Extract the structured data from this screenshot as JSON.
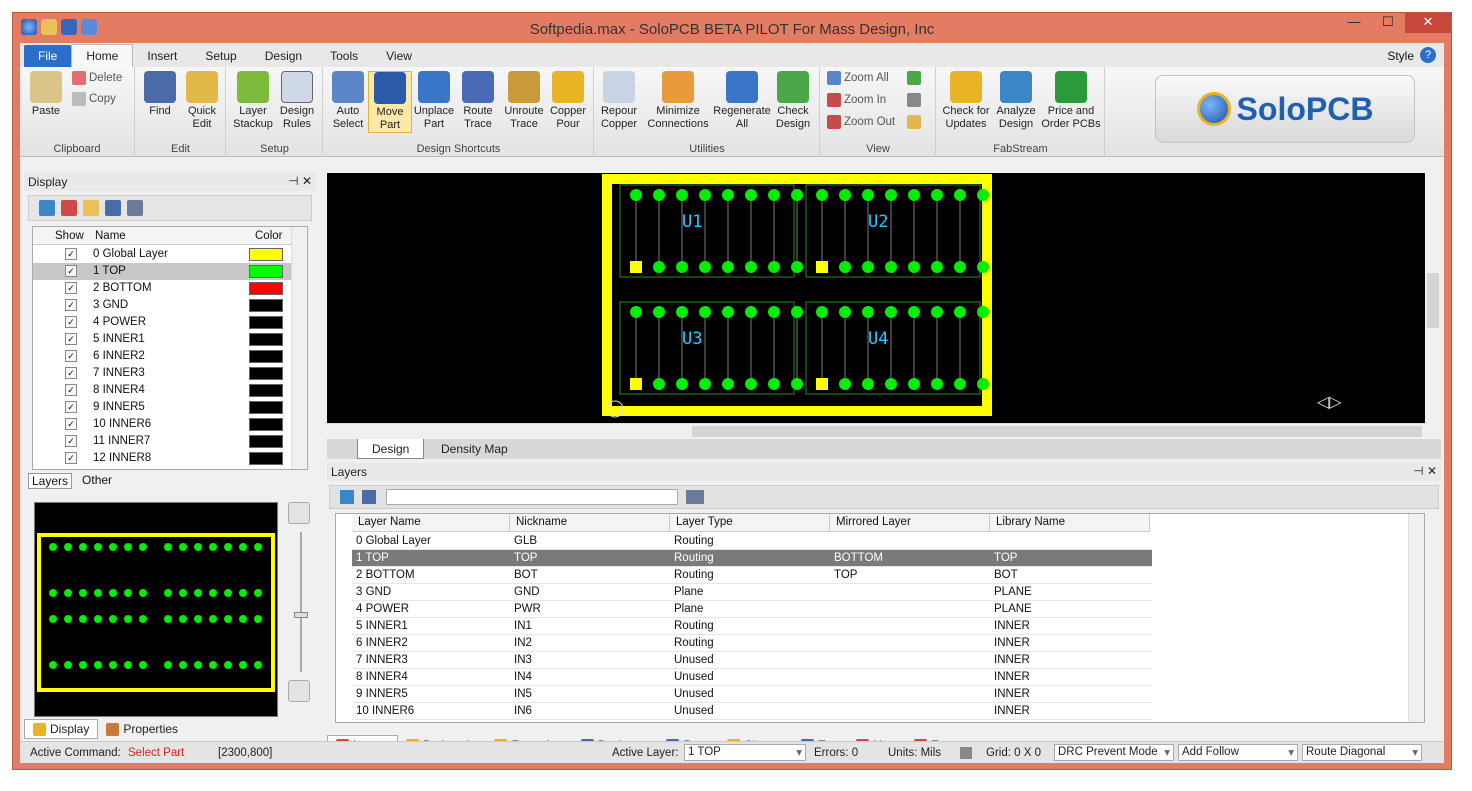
{
  "window": {
    "title": "Softpedia.max - SoloPCB BETA PILOT For Mass Design, Inc"
  },
  "tabs": {
    "file": "File",
    "home": "Home",
    "insert": "Insert",
    "setup": "Setup",
    "design": "Design",
    "tools": "Tools",
    "view": "View",
    "style": "Style"
  },
  "ribbon": {
    "clipboard": {
      "label": "Clipboard",
      "paste": "Paste",
      "delete": "Delete",
      "copy": "Copy"
    },
    "edit": {
      "label": "Edit",
      "find": "Find",
      "quick": "Quick Edit"
    },
    "setup": {
      "label": "Setup",
      "layer": "Layer Stackup",
      "rules": "Design Rules"
    },
    "shortcuts": {
      "label": "Design Shortcuts",
      "auto": "Auto Select",
      "move": "Move Part",
      "unplace": "Unplace Part",
      "route": "Route Trace",
      "unroute": "Unroute Trace",
      "copper": "Copper Pour"
    },
    "utilities": {
      "label": "Utilities",
      "repour": "Repour Copper",
      "minimize": "Minimize Connections",
      "regen": "Regenerate All",
      "check": "Check Design"
    },
    "view": {
      "label": "View",
      "zoomall": "Zoom All",
      "zoomin": "Zoom In",
      "zoomout": "Zoom Out"
    },
    "fab": {
      "label": "FabStream",
      "updates": "Check for Updates",
      "analyze": "Analyze Design",
      "order": "Price and Order PCBs"
    },
    "logo": "SoloPCB"
  },
  "display": {
    "title": "Display",
    "col_show": "Show",
    "col_name": "Name",
    "col_color": "Color",
    "rows": [
      {
        "name": "0 Global Layer",
        "color": "#ffff00"
      },
      {
        "name": "1 TOP",
        "color": "#00ff00"
      },
      {
        "name": "2 BOTTOM",
        "color": "#ff0000"
      },
      {
        "name": "3 GND",
        "color": "#000000"
      },
      {
        "name": "4 POWER",
        "color": "#000000"
      },
      {
        "name": "5 INNER1",
        "color": "#000000"
      },
      {
        "name": "6 INNER2",
        "color": "#000000"
      },
      {
        "name": "7 INNER3",
        "color": "#000000"
      },
      {
        "name": "8 INNER4",
        "color": "#000000"
      },
      {
        "name": "9 INNER5",
        "color": "#000000"
      },
      {
        "name": "10 INNER6",
        "color": "#000000"
      },
      {
        "name": "11 INNER7",
        "color": "#000000"
      },
      {
        "name": "12 INNER8",
        "color": "#000000"
      }
    ],
    "tab_layers": "Layers",
    "tab_other": "Other"
  },
  "canvas": {
    "parts": [
      "U1",
      "U2",
      "U3",
      "U4"
    ],
    "tab_design": "Design",
    "tab_density": "Density Map"
  },
  "layers": {
    "title": "Layers",
    "cols": [
      "Layer Name",
      "Nickname",
      "Layer Type",
      "Mirrored Layer",
      "Library Name"
    ],
    "rows": [
      [
        "0 Global Layer",
        "GLB",
        "Routing",
        "",
        ""
      ],
      [
        "1 TOP",
        "TOP",
        "Routing",
        "BOTTOM",
        "TOP"
      ],
      [
        "2 BOTTOM",
        "BOT",
        "Routing",
        "TOP",
        "BOT"
      ],
      [
        "3 GND",
        "GND",
        "Plane",
        "",
        "PLANE"
      ],
      [
        "4 POWER",
        "PWR",
        "Plane",
        "",
        "PLANE"
      ],
      [
        "5 INNER1",
        "IN1",
        "Routing",
        "",
        "INNER"
      ],
      [
        "6 INNER2",
        "IN2",
        "Routing",
        "",
        "INNER"
      ],
      [
        "7 INNER3",
        "IN3",
        "Unused",
        "",
        "INNER"
      ],
      [
        "8 INNER4",
        "IN4",
        "Unused",
        "",
        "INNER"
      ],
      [
        "9 INNER5",
        "IN5",
        "Unused",
        "",
        "INNER"
      ],
      [
        "10 INNER6",
        "IN6",
        "Unused",
        "",
        "INNER"
      ]
    ]
  },
  "bottomtabs_left": {
    "display": "Display",
    "properties": "Properties"
  },
  "bottomtabs_right": [
    "Layers",
    "Padstacks",
    "Footprints",
    "Packages",
    "Parts",
    "Shapes",
    "Text",
    "Nets",
    "Errors"
  ],
  "status": {
    "active_cmd_label": "Active Command:",
    "active_cmd": "Select Part",
    "coords": "[2300,800]",
    "active_layer_label": "Active Layer:",
    "active_layer": "1 TOP",
    "errors": "Errors: 0",
    "units": "Units: Mils",
    "grid": "Grid: 0 X 0",
    "drc": "DRC Prevent Mode",
    "follow": "Add Follow",
    "route": "Route Diagonal"
  },
  "colors": {
    "accent": "#2a6fc9",
    "board": "#ffff00",
    "pad": "#00ee00",
    "part_label": "#22ccff"
  }
}
